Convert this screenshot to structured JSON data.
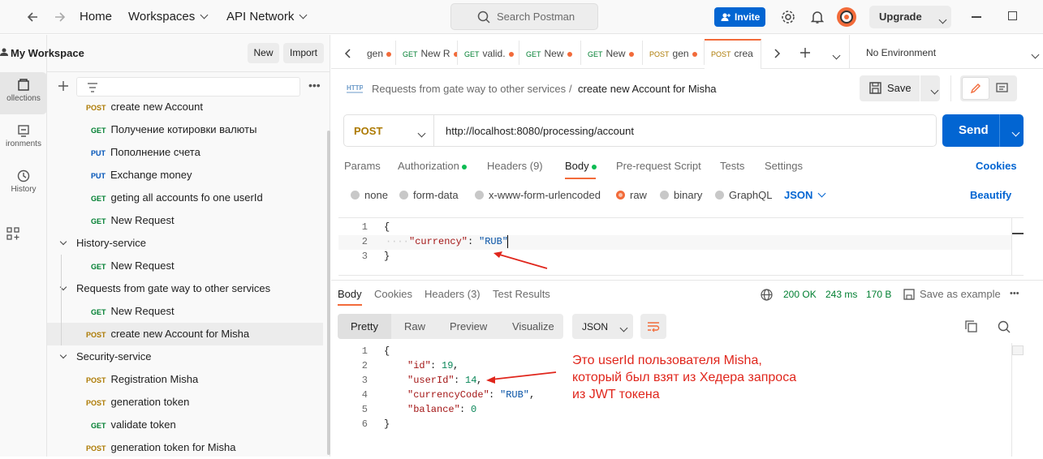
{
  "topbar": {
    "home": "Home",
    "workspaces": "Workspaces",
    "api_network": "API Network",
    "search_placeholder": "Search Postman",
    "invite": "Invite",
    "upgrade": "Upgrade"
  },
  "rail": {
    "collections": "ollections",
    "environments": "ironments",
    "history": "History"
  },
  "sidebar": {
    "workspace_title": "My Workspace",
    "new_btn": "New",
    "import_btn": "Import",
    "items": [
      {
        "method": "POST",
        "name": "create new Account"
      },
      {
        "method": "GET",
        "name": "Получение котировки валюты"
      },
      {
        "method": "PUT",
        "name": "Пополнение счета"
      },
      {
        "method": "PUT",
        "name": "Exchange money"
      },
      {
        "method": "GET",
        "name": "geting all accounts fo one userId"
      },
      {
        "method": "GET",
        "name": "New Request"
      },
      {
        "folder": "History-service"
      },
      {
        "method": "GET",
        "name": "New Request"
      },
      {
        "folder": "Requests from gate way to other services"
      },
      {
        "method": "GET",
        "name": "New Request"
      },
      {
        "method": "POST",
        "name": "create new Account for Misha"
      },
      {
        "folder": "Security-service"
      },
      {
        "method": "POST",
        "name": "Registration Misha"
      },
      {
        "method": "POST",
        "name": "generation token"
      },
      {
        "method": "GET",
        "name": "validate token"
      },
      {
        "method": "POST",
        "name": "generation token for Misha"
      }
    ]
  },
  "tabs": [
    {
      "method": "",
      "name": "gen"
    },
    {
      "method": "GET",
      "name": "New R"
    },
    {
      "method": "GET",
      "name": "valid."
    },
    {
      "method": "GET",
      "name": "New"
    },
    {
      "method": "GET",
      "name": "New"
    },
    {
      "method": "POST",
      "name": "gen"
    },
    {
      "method": "POST",
      "name": "crea"
    }
  ],
  "environment": "No Environment",
  "request": {
    "breadcrumb_parent": "Requests from gate way to other services",
    "breadcrumb_sep": "/",
    "title": "create new Account for Misha",
    "save": "Save",
    "method": "POST",
    "url": "http://localhost:8080/processing/account",
    "send": "Send"
  },
  "req_tabs": {
    "params": "Params",
    "authorization": "Authorization",
    "headers": "Headers (9)",
    "body": "Body",
    "prerequest": "Pre-request Script",
    "tests": "Tests",
    "settings": "Settings",
    "cookies": "Cookies"
  },
  "body_types": {
    "none": "none",
    "form_data": "form-data",
    "urlencoded": "x-www-form-urlencoded",
    "raw": "raw",
    "binary": "binary",
    "graphql": "GraphQL",
    "json": "JSON",
    "beautify": "Beautify"
  },
  "req_body": {
    "lines": [
      "1",
      "2",
      "3"
    ],
    "l1": "{",
    "l2_key": "\"currency\"",
    "l2_colon": ": ",
    "l2_val": "\"RUB\"",
    "l3": "}"
  },
  "response": {
    "tabs": {
      "body": "Body",
      "cookies": "Cookies",
      "headers": "Headers (3)",
      "tests": "Test Results"
    },
    "status": "200 OK",
    "time": "243 ms",
    "size": "170 B",
    "save_example": "Save as example",
    "views": {
      "pretty": "Pretty",
      "raw": "Raw",
      "preview": "Preview",
      "visualize": "Visualize",
      "format": "JSON"
    },
    "lines": [
      "1",
      "2",
      "3",
      "4",
      "5",
      "6"
    ],
    "l1": "{",
    "id_key": "\"id\"",
    "id_val": "19",
    "uid_key": "\"userId\"",
    "uid_val": "14",
    "cc_key": "\"currencyCode\"",
    "cc_val": "\"RUB\"",
    "bal_key": "\"balance\"",
    "bal_val": "0",
    "l6": "}"
  },
  "annotation": {
    "line1": "Это userId пользователя Misha,",
    "line2": "который был взят из Хедера запроса",
    "line3": "из JWT токена",
    "color": "#e0261c"
  }
}
